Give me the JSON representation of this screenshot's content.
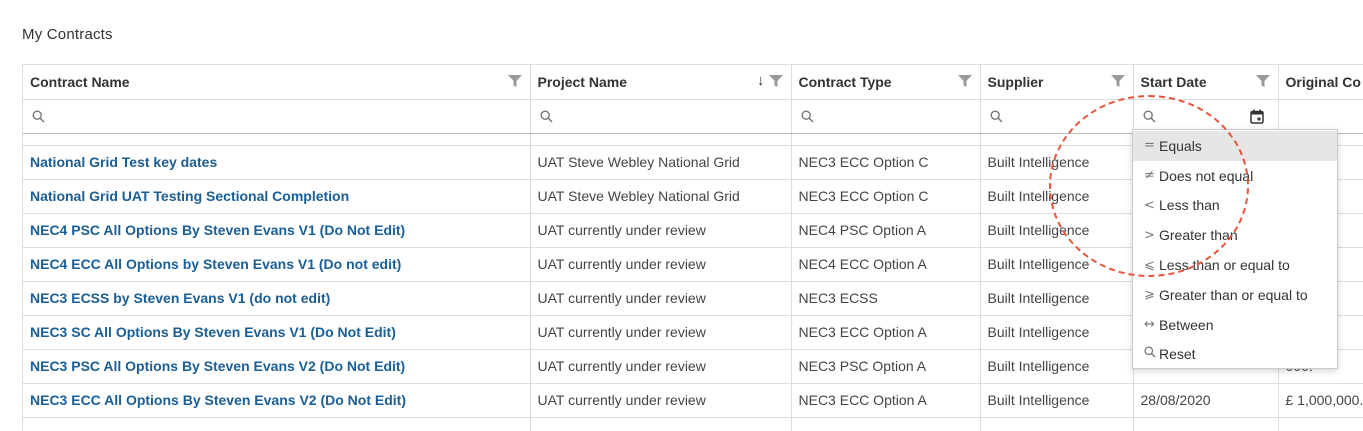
{
  "page": {
    "title": "My Contracts"
  },
  "columns": [
    {
      "label": "Contract Name"
    },
    {
      "label": "Project Name",
      "sort": "descending"
    },
    {
      "label": "Contract Type"
    },
    {
      "label": "Supplier"
    },
    {
      "label": "Start Date"
    },
    {
      "label": "Original Co"
    }
  ],
  "rows": [
    {
      "contract": "National Grid Test key dates",
      "project": "UAT Steve Webley National Grid",
      "type": "NEC3 ECC Option C",
      "supplier": "Built Intelligence",
      "start": "",
      "original": "0.00"
    },
    {
      "contract": "National Grid UAT Testing Sectional Completion",
      "project": "UAT Steve Webley National Grid",
      "type": "NEC3 ECC Option C",
      "supplier": "Built Intelligence",
      "start": "",
      "original": "0.00"
    },
    {
      "contract": "NEC4 PSC All Options By Steven Evans V1 (Do Not Edit)",
      "project": "UAT currently under review",
      "type": "NEC4 PSC Option A",
      "supplier": "Built Intelligence",
      "start": "",
      "original": "00."
    },
    {
      "contract": "NEC4 ECC All Options by Steven Evans V1 (Do not edit)",
      "project": "UAT currently under review",
      "type": "NEC4 ECC Option A",
      "supplier": "Built Intelligence",
      "start": "",
      "original": "000."
    },
    {
      "contract": "NEC3 ECSS by Steven Evans V1 (do not edit)",
      "project": "UAT currently under review",
      "type": "NEC3 ECSS",
      "supplier": "Built Intelligence",
      "start": "",
      "original": "000."
    },
    {
      "contract": "NEC3 SC All Options By Steven Evans V1 (Do Not Edit)",
      "project": "UAT currently under review",
      "type": "NEC3 ECC Option A",
      "supplier": "Built Intelligence",
      "start": "",
      "original": "000."
    },
    {
      "contract": "NEC3 PSC All Options By Steven Evans V2 (Do Not Edit)",
      "project": "UAT currently under review",
      "type": "NEC3 PSC Option A",
      "supplier": "Built Intelligence",
      "start": "",
      "original": "000."
    },
    {
      "contract": "NEC3 ECC All Options By Steven Evans V2 (Do Not Edit)",
      "project": "UAT currently under review",
      "type": "NEC3 ECC Option A",
      "supplier": "Built Intelligence",
      "start": "28/08/2020",
      "original": "£ 1,000,000."
    }
  ],
  "filter_menu": {
    "items": [
      {
        "glyph": "=",
        "label": "Equals",
        "selected": true
      },
      {
        "glyph": "≠",
        "label": "Does not equal"
      },
      {
        "glyph": "<",
        "label": "Less than"
      },
      {
        "glyph": ">",
        "label": "Greater than"
      },
      {
        "glyph": "⩽",
        "label": "Less than or equal to"
      },
      {
        "glyph": "⩾",
        "label": "Greater than or equal to"
      },
      {
        "glyph": "↔",
        "label": "Between"
      },
      {
        "glyph": "search-icon",
        "label": "Reset"
      }
    ]
  },
  "colors": {
    "link": "#1a5e96",
    "annotation": "#e8553b",
    "selected_bg": "#e6e6e6",
    "border": "#dddddd"
  }
}
